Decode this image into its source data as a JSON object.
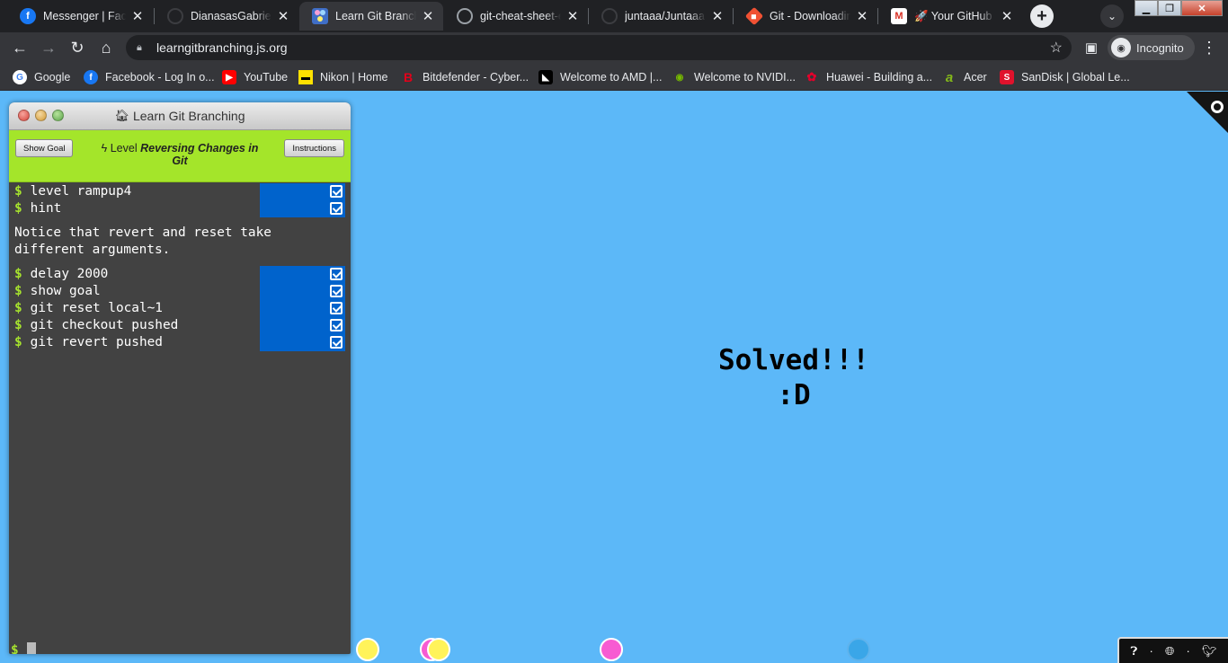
{
  "tabs": [
    {
      "title": "Messenger | Facebook",
      "icon": "facebook-icon",
      "active": false
    },
    {
      "title": "DianasasGabrielKing",
      "icon": "github-icon",
      "active": false
    },
    {
      "title": "Learn Git Branching",
      "icon": "lgb-icon",
      "active": true
    },
    {
      "title": "git-cheat-sheet-education",
      "icon": "github-icon",
      "active": false
    },
    {
      "title": "juntaaa/Juntaaa",
      "icon": "github-icon",
      "active": false
    },
    {
      "title": "Git - Downloading",
      "icon": "git-icon",
      "active": false
    },
    {
      "title": "🚀 Your GitHub launch",
      "icon": "gmail-icon",
      "active": false
    }
  ],
  "address_bar": {
    "url": "learngitbranching.js.org"
  },
  "profile": {
    "label": "Incognito"
  },
  "bookmarks": [
    {
      "label": "Google",
      "icon": "google-icon"
    },
    {
      "label": "Facebook - Log In o...",
      "icon": "facebook-icon"
    },
    {
      "label": "YouTube",
      "icon": "youtube-icon"
    },
    {
      "label": "Nikon | Home",
      "icon": "nikon-icon"
    },
    {
      "label": "Bitdefender - Cyber...",
      "icon": "bitdefender-icon"
    },
    {
      "label": "Welcome to AMD |...",
      "icon": "amd-icon"
    },
    {
      "label": "Welcome to NVIDI...",
      "icon": "nvidia-icon"
    },
    {
      "label": "Huawei - Building a...",
      "icon": "huawei-icon"
    },
    {
      "label": "Acer",
      "icon": "acer-icon"
    },
    {
      "label": "SanDisk | Global Le...",
      "icon": "sandisk-icon"
    }
  ],
  "app": {
    "window_title": "Learn Git Branching",
    "show_goal": "Show Goal",
    "instructions": "Instructions",
    "level_prefix": "Level",
    "level_name": "Reversing Changes in Git",
    "prompt": "$",
    "commands_a": [
      "level rampup4",
      "hint"
    ],
    "hint_text": "Notice that revert and reset take\ndifferent arguments.",
    "commands_b": [
      "delay 2000",
      "show goal",
      "git reset local~1",
      "git checkout pushed",
      "git revert pushed"
    ]
  },
  "result": {
    "line1": "Solved!!!",
    "line2": ":D"
  },
  "colors": {
    "background": "#5cb8f8",
    "level_bar": "#a4e52a",
    "terminal": "#424242",
    "command_ok": "#0063cc",
    "prompt": "#a6e22e"
  }
}
